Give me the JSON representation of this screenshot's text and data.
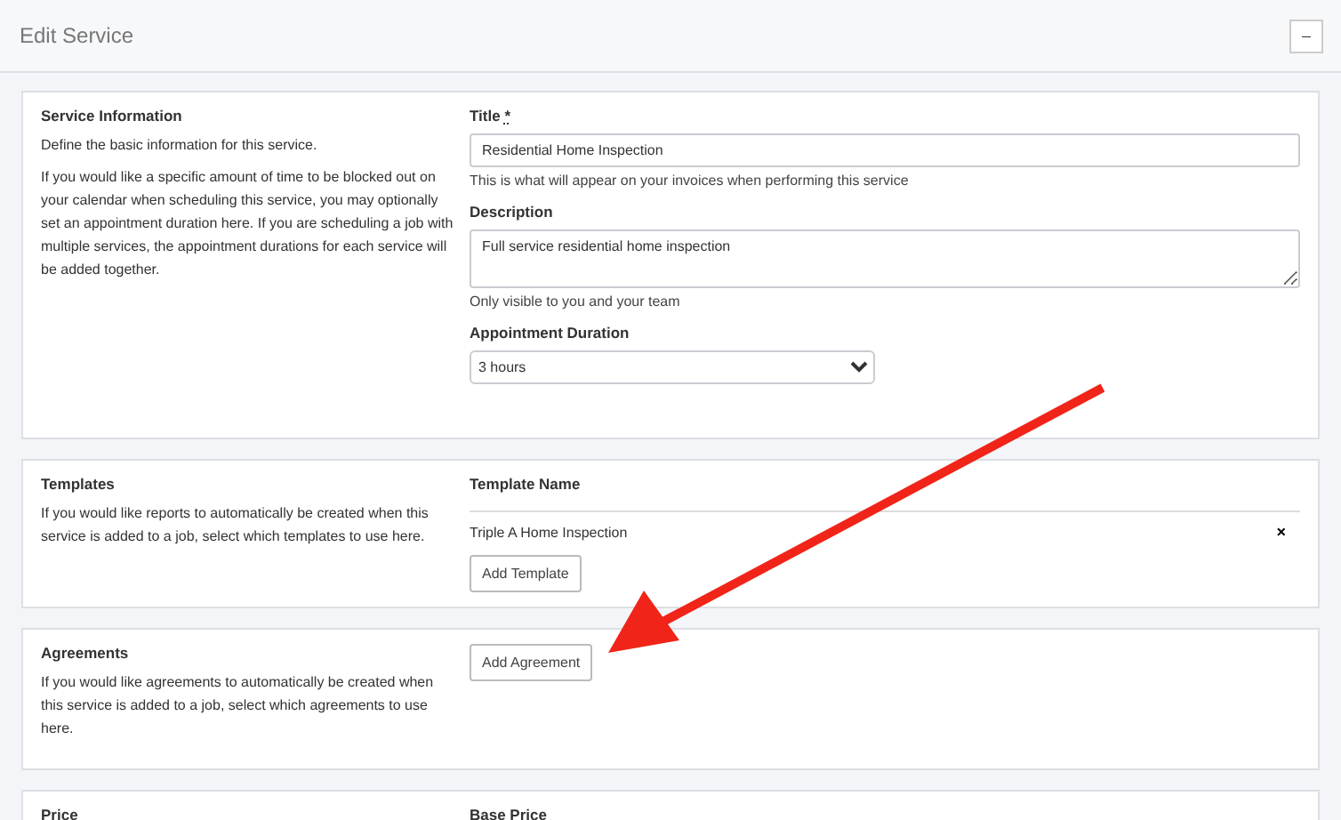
{
  "header": {
    "title": "Edit Service",
    "collapse_button": "–"
  },
  "sections": [
    {
      "kind": "info",
      "title": "Service Information",
      "paragraphs": [
        "Define the basic information for this service.",
        "If you would like a specific amount of time to be blocked out on your calendar when scheduling this service, you may optionally set an appointment duration here. If you are scheduling a job with multiple services, the appointment durations for each service will be added together."
      ],
      "fields": [
        {
          "kind": "input",
          "label": "Title",
          "required_mark": "*",
          "value": "Residential Home Inspection",
          "help": "This is what will appear on your invoices when performing this service"
        },
        {
          "kind": "textarea",
          "label": "Description",
          "value": "Full service residential home inspection",
          "help": "Only visible to you and your team"
        },
        {
          "kind": "select",
          "label": "Appointment Duration",
          "value": "3 hours"
        }
      ]
    },
    {
      "kind": "templates",
      "title": "Templates",
      "paragraphs": [
        "If you would like reports to automatically be created when this service is added to a job, select which templates to use here."
      ],
      "column": "Template Name",
      "rows": [
        {
          "name": "Triple A Home Inspection",
          "remove": "×"
        }
      ],
      "button": "Add Template"
    },
    {
      "kind": "agreements",
      "title": "Agreements",
      "paragraphs": [
        "If you would like agreements to automatically be created when this service is added to a job, select which agreements to use here."
      ],
      "button": "Add Agreement"
    },
    {
      "kind": "price",
      "title": "Price",
      "column": "Base Price"
    }
  ]
}
